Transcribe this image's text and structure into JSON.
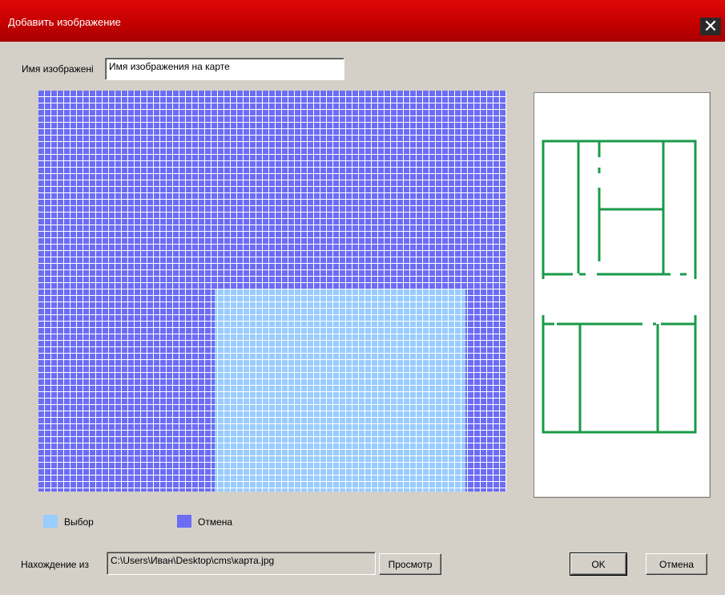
{
  "window": {
    "title": "Добавить изображение",
    "close_glyph": "✕",
    "title_bar_color": "#c40000"
  },
  "image_name": {
    "label": "Имя изображені",
    "value": "Имя изображения на карте"
  },
  "grid": {
    "outer_color": "#6c6cf4",
    "selection_color": "#99ccff"
  },
  "legend": {
    "select": {
      "label": "Выбор",
      "color": "#99ccff"
    },
    "cancel": {
      "label": "Отмена",
      "color": "#6c6cf4"
    }
  },
  "location": {
    "label": "Нахождение из",
    "value": "C:\\Users\\Иван\\Desktop\\cms\\карта.jpg",
    "browse_label": "Просмотр"
  },
  "buttons": {
    "ok": "OK",
    "cancel": "Отмена"
  },
  "preview": {
    "line_color": "#1a9a4a"
  }
}
